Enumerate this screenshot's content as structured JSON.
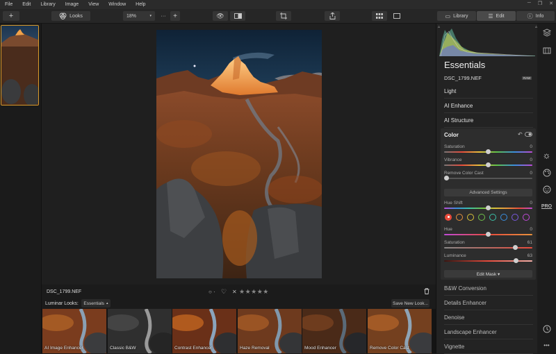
{
  "menu": [
    "File",
    "Edit",
    "Library",
    "Image",
    "View",
    "Window",
    "Help"
  ],
  "toolbar": {
    "add_label": "+",
    "looks_label": "Looks",
    "zoom_value": "18%",
    "zoom_out": "···",
    "zoom_in": "+",
    "library_tab": "Library",
    "edit_tab": "Edit",
    "info_tab": "Info"
  },
  "image": {
    "filename": "DSC_1799.NEF",
    "raw_badge": "RAW",
    "rating_label": "○ ·",
    "reject_mark": "✕",
    "stars": "★★★★★"
  },
  "looks": {
    "label": "Luminar Looks:",
    "category": "Essentials",
    "save_button": "Save New Look...",
    "items": [
      "AI Image Enhancer",
      "Classic B&W",
      "Contrast Enhancer",
      "Haze Removal",
      "Mood Enhancer",
      "Remove Color Cast"
    ]
  },
  "panel": {
    "title": "Essentials",
    "filename": "DSC_1799.NEF",
    "raw_badge": "RAW",
    "sections_top": [
      "Light",
      "AI Enhance",
      "AI Structure"
    ],
    "color": {
      "title": "Color",
      "saturation_label": "Saturation",
      "saturation_value": "0",
      "vibrance_label": "Vibrance",
      "vibrance_value": "0",
      "cast_label": "Remove Color Cast",
      "cast_value": "0",
      "advanced_label": "Advanced Settings",
      "hue_shift_label": "Hue Shift",
      "hue_shift_value": "0",
      "hue_label": "Hue",
      "hue_value": "0",
      "sat2_label": "Saturation",
      "sat2_value": "61",
      "lum_label": "Luminance",
      "lum_value": "63",
      "edit_mask": "Edit Mask ▾",
      "swatches": [
        "#e84b3c",
        "#e8923c",
        "#d9c33a",
        "#6fc24a",
        "#3cc2a8",
        "#3a8fe0",
        "#7a5ae0",
        "#c04ad8"
      ]
    },
    "sections_bottom": [
      "B&W Conversion",
      "Details Enhancer",
      "Denoise",
      "Landscape Enhancer",
      "Vignette"
    ]
  },
  "rail": {
    "pro_label": "PRO",
    "more_label": "•••"
  },
  "colors": {
    "accent": "#d99a2b",
    "panel_bg": "#232323",
    "canvas_bg": "#1f1f1f"
  }
}
